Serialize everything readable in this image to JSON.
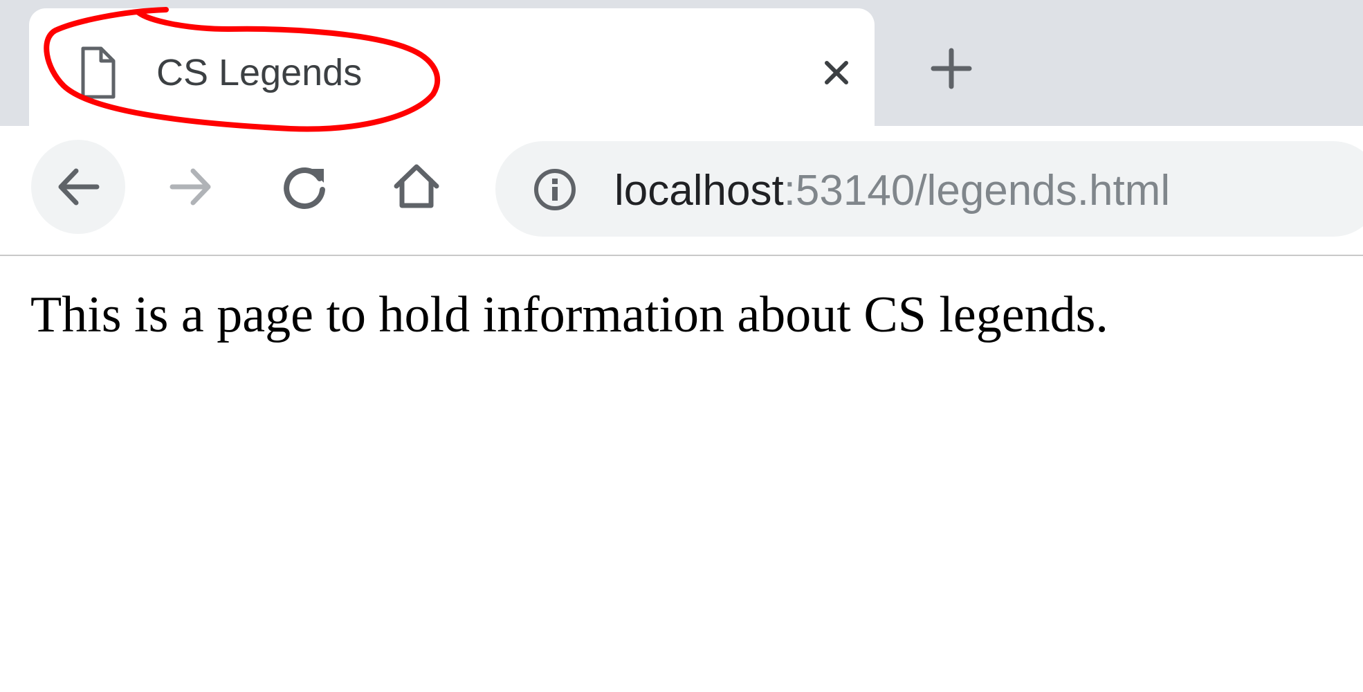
{
  "browser": {
    "tab": {
      "icon": "document-icon",
      "title": "CS Legends",
      "close_icon": "close-icon"
    },
    "new_tab_icon": "plus-icon",
    "toolbar": {
      "back_icon": "arrow-left-icon",
      "forward_icon": "arrow-right-icon",
      "reload_icon": "reload-icon",
      "home_icon": "home-icon"
    },
    "omnibox": {
      "info_icon": "info-icon",
      "url_host": "localhost",
      "url_rest": ":53140/legends.html"
    }
  },
  "page": {
    "text": "This is a page to hold information about CS legends."
  },
  "annotation": {
    "color": "#ff0000",
    "shape": "hand-drawn ellipse around tab title"
  },
  "colors": {
    "tabstrip": "#dee1e6",
    "omnibox": "#f1f3f4",
    "icon": "#5f6368",
    "icon_disabled": "#b0b3b7"
  }
}
